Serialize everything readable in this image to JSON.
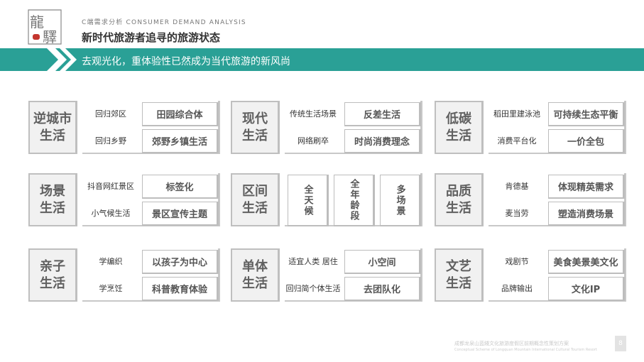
{
  "header": {
    "logo_chars": [
      "龍",
      "驛"
    ],
    "subtitle_en": "C端需求分析  CONSUMER DEMAND ANALYSIS",
    "title": "新时代旅游者追寻的旅游状态"
  },
  "banner": {
    "text": "去观光化，重体验性已然成为当代旅游的新风尚",
    "color": "#2aa096"
  },
  "cards": [
    {
      "title": "逆城市\n生活",
      "rows": [
        {
          "label": "回归郊区",
          "value": "田园综合体"
        },
        {
          "label": "回归乡野",
          "value": "郊野乡镇生活"
        }
      ]
    },
    {
      "title": "现代\n生活",
      "rows": [
        {
          "label": "传统生活场景",
          "value": "反差生活"
        },
        {
          "label": "网络刷卒",
          "value": "时尚消费理念"
        }
      ]
    },
    {
      "title": "低碳\n生活",
      "rows": [
        {
          "label": "稻田里建泳池",
          "value": "可持续生态平衡"
        },
        {
          "label": "消费平台化",
          "value": "一价全包"
        }
      ]
    },
    {
      "title": "场景\n生活",
      "rows": [
        {
          "label": "抖音网红景区",
          "value": "标签化"
        },
        {
          "label": "小气候生活",
          "value": "景区宣传主题"
        }
      ]
    },
    {
      "title": "区间\n生活",
      "vertical": [
        "全天候",
        "全年龄段",
        "多场景"
      ]
    },
    {
      "title": "品质\n生活",
      "rows": [
        {
          "label": "肯德基",
          "value": "体现精英需求"
        },
        {
          "label": "麦当劳",
          "value": "塑造消费场景"
        }
      ]
    },
    {
      "title": "亲子\n生活",
      "rows": [
        {
          "label": "学编织",
          "value": "以孩子为中心"
        },
        {
          "label": "学烹饪",
          "value": "科普教育体验"
        }
      ]
    },
    {
      "title": "单体\n生活",
      "rows": [
        {
          "label": "适宜人类 居住",
          "value": "小空间"
        },
        {
          "label": "回归简个体生活",
          "value": "去团队化"
        }
      ]
    },
    {
      "title": "文艺\n生活",
      "rows": [
        {
          "label": "戏剧节",
          "value": "美食美景美文化"
        },
        {
          "label": "品牌输出",
          "value": "文化IP"
        }
      ]
    }
  ],
  "footer": {
    "cn": "成都龙泉山蓝綫文化旅游度假区前期概念性策划方案",
    "en": "Conceptual Scheme of Longquan Mountain International Cultural Tourism Resort",
    "page": "8"
  }
}
